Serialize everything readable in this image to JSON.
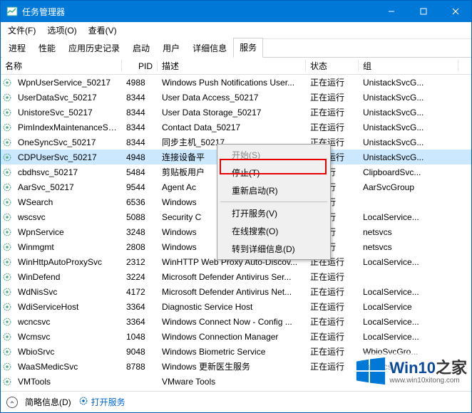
{
  "window": {
    "title": "任务管理器"
  },
  "menu": {
    "file": "文件(F)",
    "options": "选项(O)",
    "view": "查看(V)"
  },
  "tabs": [
    "进程",
    "性能",
    "应用历史记录",
    "启动",
    "用户",
    "详细信息",
    "服务"
  ],
  "active_tab_index": 6,
  "columns": {
    "name": "名称",
    "pid": "PID",
    "desc": "描述",
    "status": "状态",
    "group": "组"
  },
  "rows": [
    {
      "name": "WpnUserService_50217",
      "pid": "4988",
      "desc": "Windows Push Notifications User...",
      "status": "正在运行",
      "group": "UnistackSvcG..."
    },
    {
      "name": "UserDataSvc_50217",
      "pid": "8344",
      "desc": "User Data Access_50217",
      "status": "正在运行",
      "group": "UnistackSvcG..."
    },
    {
      "name": "UnistoreSvc_50217",
      "pid": "8344",
      "desc": "User Data Storage_50217",
      "status": "正在运行",
      "group": "UnistackSvcG..."
    },
    {
      "name": "PimIndexMaintenanceSv...",
      "pid": "8344",
      "desc": "Contact Data_50217",
      "status": "正在运行",
      "group": "UnistackSvcG..."
    },
    {
      "name": "OneSyncSvc_50217",
      "pid": "8344",
      "desc": "同步主机_50217",
      "status": "正在运行",
      "group": "UnistackSvcG..."
    },
    {
      "name": "CDPUserSvc_50217",
      "pid": "4948",
      "desc": "连接设备平",
      "status": "正在运行",
      "group": "UnistackSvcG..."
    },
    {
      "name": "cbdhsvc_50217",
      "pid": "5484",
      "desc": "剪贴板用户",
      "status": "在运行",
      "group": "ClipboardSvc..."
    },
    {
      "name": "AarSvc_50217",
      "pid": "9544",
      "desc": "Agent Ac",
      "status": "在运行",
      "group": "AarSvcGroup"
    },
    {
      "name": "WSearch",
      "pid": "6536",
      "desc": "Windows",
      "status": "在运行",
      "group": ""
    },
    {
      "name": "wscsvc",
      "pid": "5088",
      "desc": "Security C",
      "status": "在运行",
      "group": "LocalService..."
    },
    {
      "name": "WpnService",
      "pid": "3248",
      "desc": "Windows",
      "status": "在运行",
      "group": "netsvcs"
    },
    {
      "name": "Winmgmt",
      "pid": "2808",
      "desc": "Windows",
      "status": "在运行",
      "group": "netsvcs"
    },
    {
      "name": "WinHttpAutoProxySvc",
      "pid": "2312",
      "desc": "WinHTTP Web Proxy Auto-Discov...",
      "status": "正在运行",
      "group": "LocalService..."
    },
    {
      "name": "WinDefend",
      "pid": "3224",
      "desc": "Microsoft Defender Antivirus Ser...",
      "status": "正在运行",
      "group": ""
    },
    {
      "name": "WdNisSvc",
      "pid": "4172",
      "desc": "Microsoft Defender Antivirus Net...",
      "status": "正在运行",
      "group": "LocalService..."
    },
    {
      "name": "WdiServiceHost",
      "pid": "3364",
      "desc": "Diagnostic Service Host",
      "status": "正在运行",
      "group": "LocalService"
    },
    {
      "name": "wcncsvc",
      "pid": "3364",
      "desc": "Windows Connect Now - Config ...",
      "status": "正在运行",
      "group": "LocalService..."
    },
    {
      "name": "Wcmsvc",
      "pid": "1048",
      "desc": "Windows Connection Manager",
      "status": "正在运行",
      "group": "LocalService..."
    },
    {
      "name": "WbioSrvc",
      "pid": "9048",
      "desc": "Windows Biometric Service",
      "status": "正在运行",
      "group": "WbioSvcGro..."
    },
    {
      "name": "WaaSMedicSvc",
      "pid": "8788",
      "desc": "Windows 更新医生服务",
      "status": "正在运行",
      "group": "netsvcs"
    },
    {
      "name": "VMTools",
      "pid": "",
      "desc": "VMware Tools",
      "status": "",
      "group": ""
    }
  ],
  "selected_row_index": 5,
  "context_menu": {
    "start": "开始(S)",
    "stop": "停止(T)",
    "restart": "重新启动(R)",
    "open_services": "打开服务(V)",
    "search_online": "在线搜索(O)",
    "goto_details": "转到详细信息(D)"
  },
  "statusbar": {
    "brief": "简略信息(D)",
    "open_services": "打开服务"
  },
  "watermark": {
    "brand": "Win10",
    "suffix": "之家",
    "url": "www.win10xitong.com"
  }
}
